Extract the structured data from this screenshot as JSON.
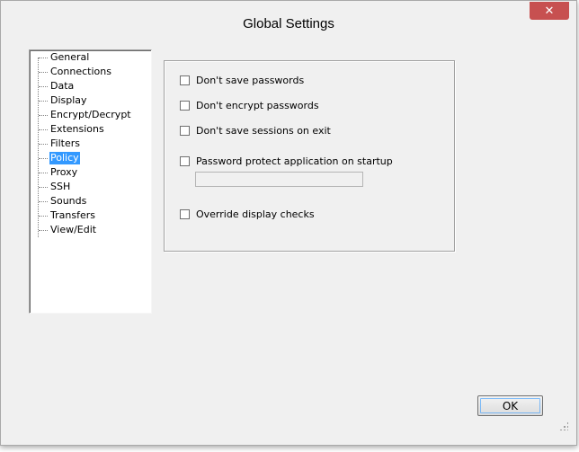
{
  "window": {
    "title": "Global Settings",
    "close_label": "✕"
  },
  "tree": {
    "items": [
      {
        "label": "General"
      },
      {
        "label": "Connections"
      },
      {
        "label": "Data"
      },
      {
        "label": "Display"
      },
      {
        "label": "Encrypt/Decrypt"
      },
      {
        "label": "Extensions"
      },
      {
        "label": "Filters"
      },
      {
        "label": "Policy"
      },
      {
        "label": "Proxy"
      },
      {
        "label": "SSH"
      },
      {
        "label": "Sounds"
      },
      {
        "label": "Transfers"
      },
      {
        "label": "View/Edit"
      }
    ],
    "selected": "Policy"
  },
  "policy": {
    "dont_save_passwords": {
      "label": "Don't save passwords",
      "checked": false
    },
    "dont_encrypt_passwords": {
      "label": "Don't encrypt passwords",
      "checked": false
    },
    "dont_save_sessions": {
      "label": "Don't save sessions on exit",
      "checked": false
    },
    "password_protect": {
      "label": "Password protect application on startup",
      "checked": false
    },
    "password_value": "",
    "override_display": {
      "label": "Override display checks",
      "checked": false
    }
  },
  "buttons": {
    "ok": "OK"
  }
}
